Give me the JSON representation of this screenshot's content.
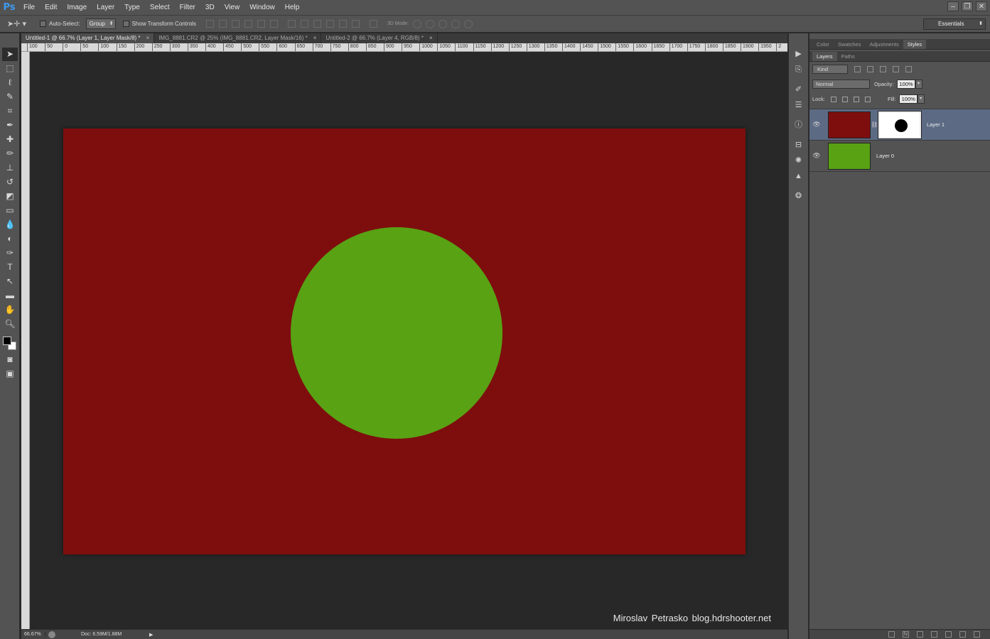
{
  "app": {
    "logo": "Ps",
    "menu": [
      "File",
      "Edit",
      "Image",
      "Layer",
      "Type",
      "Select",
      "Filter",
      "3D",
      "View",
      "Window",
      "Help"
    ],
    "window_controls": [
      "‒",
      "❐",
      "✕"
    ]
  },
  "options": {
    "auto_select_label": "Auto-Select:",
    "auto_select_value": "Group",
    "show_transform_label": "Show Transform Controls",
    "mode_label": "3D Mode:",
    "workspace": "Essentials"
  },
  "tabs": [
    {
      "label": "Untitled-1 @ 66.7% (Layer 1, Layer Mask/8) *",
      "active": true
    },
    {
      "label": "IMG_8881.CR2 @ 25% (IMG_8881.CR2, Layer Mask/16) *",
      "active": false
    },
    {
      "label": "Untitled-2 @ 66.7% (Layer 4, RGB/8) *",
      "active": false
    }
  ],
  "ruler_top": [
    "100",
    "50",
    "0",
    "50",
    "100",
    "150",
    "200",
    "250",
    "300",
    "350",
    "400",
    "450",
    "500",
    "550",
    "600",
    "650",
    "700",
    "750",
    "800",
    "850",
    "900",
    "950",
    "1000",
    "1050",
    "1100",
    "1150",
    "1200",
    "1250",
    "1300",
    "1350",
    "1400",
    "1450",
    "1500",
    "1550",
    "1600",
    "1650",
    "1700",
    "1750",
    "1800",
    "1850",
    "1900",
    "1950",
    "2"
  ],
  "canvas": {
    "layer1_color": "#7e0e0e",
    "circle_color": "#58a214",
    "watermark": "Miroslav  Petrasko  blog.hdrshooter.net"
  },
  "status": {
    "zoom": "66.67%",
    "doc": "Doc: 6.59M/1.88M"
  },
  "panels": {
    "top_tabs": [
      "Color",
      "Swatches",
      "Adjustments",
      "Styles"
    ],
    "top_active": "Styles",
    "layer_tabs": [
      "Layers",
      "Paths"
    ],
    "layer_active": "Layers",
    "kind": "Kind",
    "blend_mode": "Normal",
    "opacity_label": "Opacity:",
    "opacity": "100%",
    "lock_label": "Lock:",
    "fill_label": "Fill:",
    "fill": "100%",
    "layers": [
      {
        "name": "Layer 1",
        "color": "#7e0e0e",
        "has_mask": true,
        "selected": true
      },
      {
        "name": "Layer 0",
        "color": "#58a214",
        "has_mask": false,
        "selected": false
      }
    ]
  }
}
